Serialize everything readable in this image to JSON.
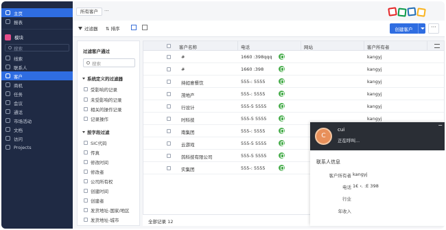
{
  "sidebar": {
    "top_items": [
      {
        "label": "主页",
        "active": true
      },
      {
        "label": "报表",
        "active": false
      }
    ],
    "module_label": "模块",
    "search_placeholder": "搜索",
    "items": [
      {
        "label": "线索",
        "active": false
      },
      {
        "label": "联系人",
        "active": false
      },
      {
        "label": "客户",
        "active": true
      },
      {
        "label": "商机",
        "active": false
      },
      {
        "label": "任务",
        "active": false
      },
      {
        "label": "会议",
        "active": false
      },
      {
        "label": "通话",
        "active": false
      },
      {
        "label": "市场活动",
        "active": false
      },
      {
        "label": "文档",
        "active": false
      },
      {
        "label": "访问",
        "active": false
      },
      {
        "label": "Projects",
        "active": false
      }
    ]
  },
  "tabbar": {
    "tab_label": "所有客户",
    "more": "···"
  },
  "toolbar": {
    "filter_label": "过滤器",
    "sort_label": "⇅ 排序",
    "create_label": "创建客户",
    "more": "···"
  },
  "filter_panel": {
    "title": "过滤客户通过",
    "search_placeholder": "搜索",
    "section1": "系统定义的过滤器",
    "section1_options": [
      "受影响的记录",
      "未受影响的记录",
      "相关的操作记录",
      "记录操作"
    ],
    "section2": "按字段过滤",
    "section2_options": [
      "SIC代码",
      "传真",
      "修改时间",
      "修改者",
      "公司所有权",
      "创建时间",
      "创建者",
      "发货地址-国家/地区",
      "发货地址-城市"
    ]
  },
  "table": {
    "columns": [
      "客户名称",
      "电话",
      "网站",
      "客户所有者"
    ],
    "rows": [
      {
        "name": "#",
        "phone": "1660 :398qqq",
        "owner": "kangyj"
      },
      {
        "name": "#",
        "phone": "1660 :398",
        "owner": "kangyj"
      },
      {
        "name": "持如意餐饮",
        "phone": "555-: 5555",
        "owner": "kangyj"
      },
      {
        "name": "茂地产",
        "phone": "555-: 5555",
        "owner": "kangyj"
      },
      {
        "name": "行设计",
        "phone": "555-5 5555",
        "owner": "kangyj"
      },
      {
        "name": "时科技",
        "phone": "555-5 5555",
        "owner": "kangyj"
      },
      {
        "name": "南集团",
        "phone": "555-: 5555",
        "owner": "kangyj"
      },
      {
        "name": "云游戏",
        "phone": "555-5 5555",
        "owner": "kangyj"
      },
      {
        "name": "鸽科技有限公司",
        "phone": "555-5 5555",
        "owner": "kangyj"
      },
      {
        "name": "实集团",
        "phone": "555-: 5555",
        "owner": "kangyj"
      }
    ],
    "footer": "全部记录 12"
  },
  "call_popup": {
    "avatar_letter": "C",
    "name": "cui",
    "status": "正在呼叫...",
    "minimize": "−",
    "section_title": "联系人信息",
    "fields": [
      {
        "label": "客户所有者",
        "value": "kangyj"
      },
      {
        "label": "电话",
        "value": "1€ ‹.  :E 398"
      },
      {
        "label": "行业",
        "value": ""
      },
      {
        "label": "年收入",
        "value": ""
      }
    ]
  },
  "colors": {
    "sidebar_bg": "#1f2a44",
    "accent": "#2f6de1",
    "phone_icon": "#4caf50",
    "popup_header": "#2a2e35"
  }
}
